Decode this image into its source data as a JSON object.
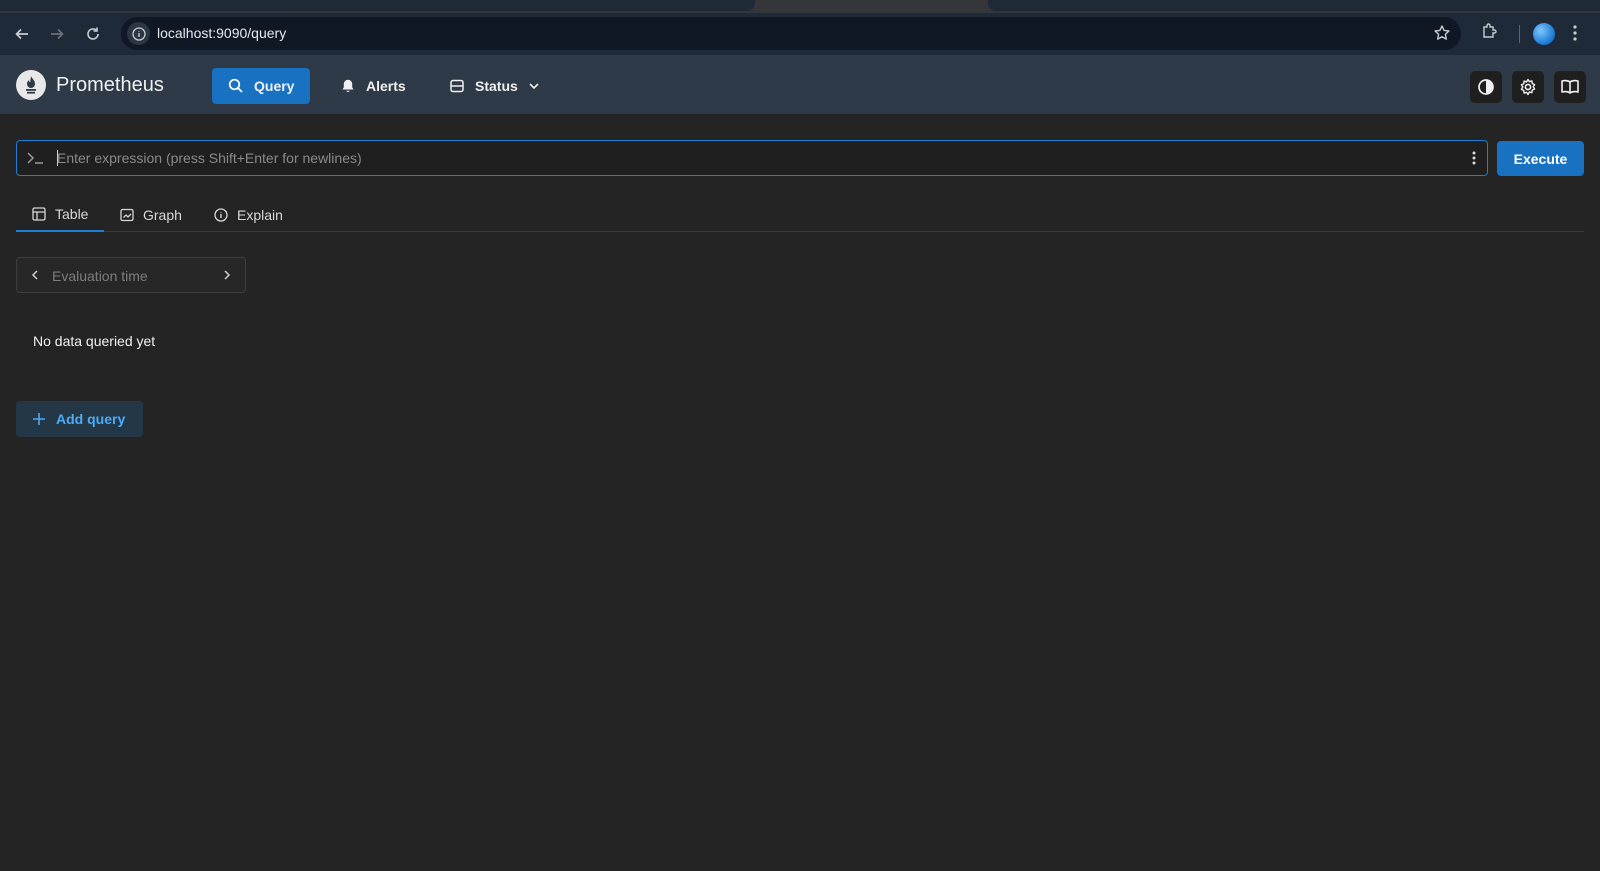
{
  "browser": {
    "url": "localhost:9090/query"
  },
  "header": {
    "brand": "Prometheus",
    "nav": [
      {
        "label": "Query",
        "icon": "search-icon",
        "active": true
      },
      {
        "label": "Alerts",
        "icon": "bell-icon",
        "active": false
      },
      {
        "label": "Status",
        "icon": "server-icon",
        "active": false
      }
    ],
    "right_icons": [
      "theme-toggle-icon",
      "gear-icon",
      "book-icon"
    ]
  },
  "expression": {
    "placeholder": "Enter expression (press Shift+Enter for newlines)",
    "value": "",
    "execute_label": "Execute"
  },
  "tabs": [
    {
      "label": "Table",
      "icon": "table-icon",
      "active": true
    },
    {
      "label": "Graph",
      "icon": "graph-icon",
      "active": false
    },
    {
      "label": "Explain",
      "icon": "info-icon",
      "active": false
    }
  ],
  "eval_time": {
    "placeholder": "Evaluation time"
  },
  "result": {
    "empty_message": "No data queried yet"
  },
  "add_query_label": "Add query",
  "colors": {
    "accent": "#1971c2",
    "header_bg": "#2e3a47",
    "page_bg": "#242424",
    "add_query_text": "#4dabf7"
  }
}
